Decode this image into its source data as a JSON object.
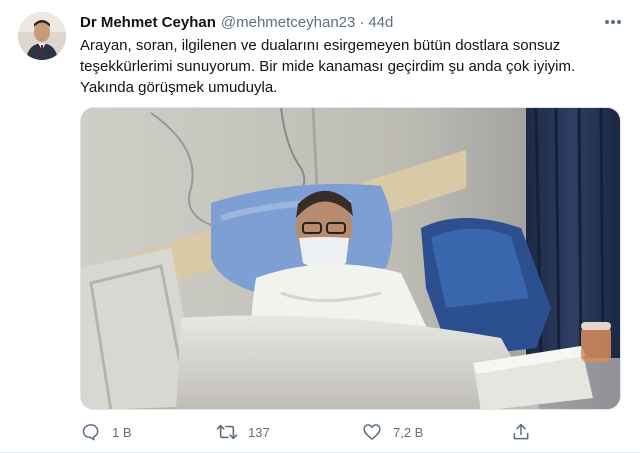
{
  "tweet": {
    "display_name": "Dr Mehmet Ceyhan",
    "handle": "@mehmetceyhan23",
    "separator": "·",
    "time": "44d",
    "text_lines": [
      "Arayan, soran, ilgilenen ve dualarını esirgemeyen bütün dostlara sonsuz",
      "teşekkürlerimi sunuyorum. Bir mide kanaması geçirdim şu anda çok iyiyim.",
      "Yakında görüşmek umuduyla."
    ],
    "actions": {
      "reply_count": "1 B",
      "retweet_count": "137",
      "like_count": "7,2 B"
    },
    "icons": {
      "avatar": "profile-photo",
      "more": "more-dots-icon",
      "reply": "reply-icon",
      "retweet": "retweet-icon",
      "like": "heart-icon",
      "share": "share-icon"
    },
    "colors": {
      "text": "#0f1419",
      "secondary": "#5b7083"
    }
  }
}
